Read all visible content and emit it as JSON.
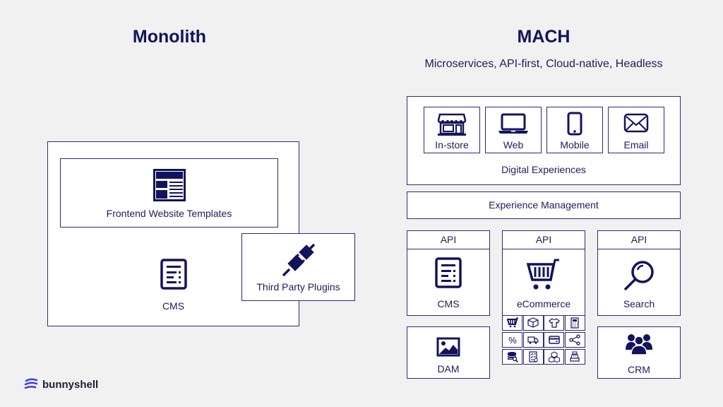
{
  "monolith": {
    "title": "Monolith",
    "frontend_label": "Frontend Website Templates",
    "cms_label": "CMS",
    "plugins_label": "Third Party Plugins"
  },
  "mach": {
    "title": "MACH",
    "subtitle": "Microservices, API-first, Cloud-native, Headless",
    "channels": [
      {
        "label": "In-store",
        "icon": "storefront-icon"
      },
      {
        "label": "Web",
        "icon": "laptop-icon"
      },
      {
        "label": "Mobile",
        "icon": "mobile-icon"
      },
      {
        "label": "Email",
        "icon": "envelope-icon"
      }
    ],
    "digital_experiences_label": "Digital Experiences",
    "experience_management_label": "Experience Management",
    "services": [
      {
        "api_label": "API",
        "label": "CMS",
        "icon": "cms-icon"
      },
      {
        "api_label": "API",
        "label": "eCommerce",
        "icon": "cart-icon"
      },
      {
        "api_label": "API",
        "label": "Search",
        "icon": "search-icon"
      }
    ],
    "dam_label": "DAM",
    "crm_label": "CRM",
    "ecommerce_grid_icons": [
      "cart-icon",
      "package-icon",
      "tshirt-icon",
      "calculator-icon",
      "percent-icon",
      "truck-icon",
      "credit-card-icon",
      "share-icon",
      "database-search-icon",
      "checklist-icon",
      "boxes-icon",
      "cash-register-icon"
    ]
  },
  "brand": {
    "name": "bunnyshell",
    "primary_color": "#12135e",
    "logo_color": "#3b3fd8"
  }
}
